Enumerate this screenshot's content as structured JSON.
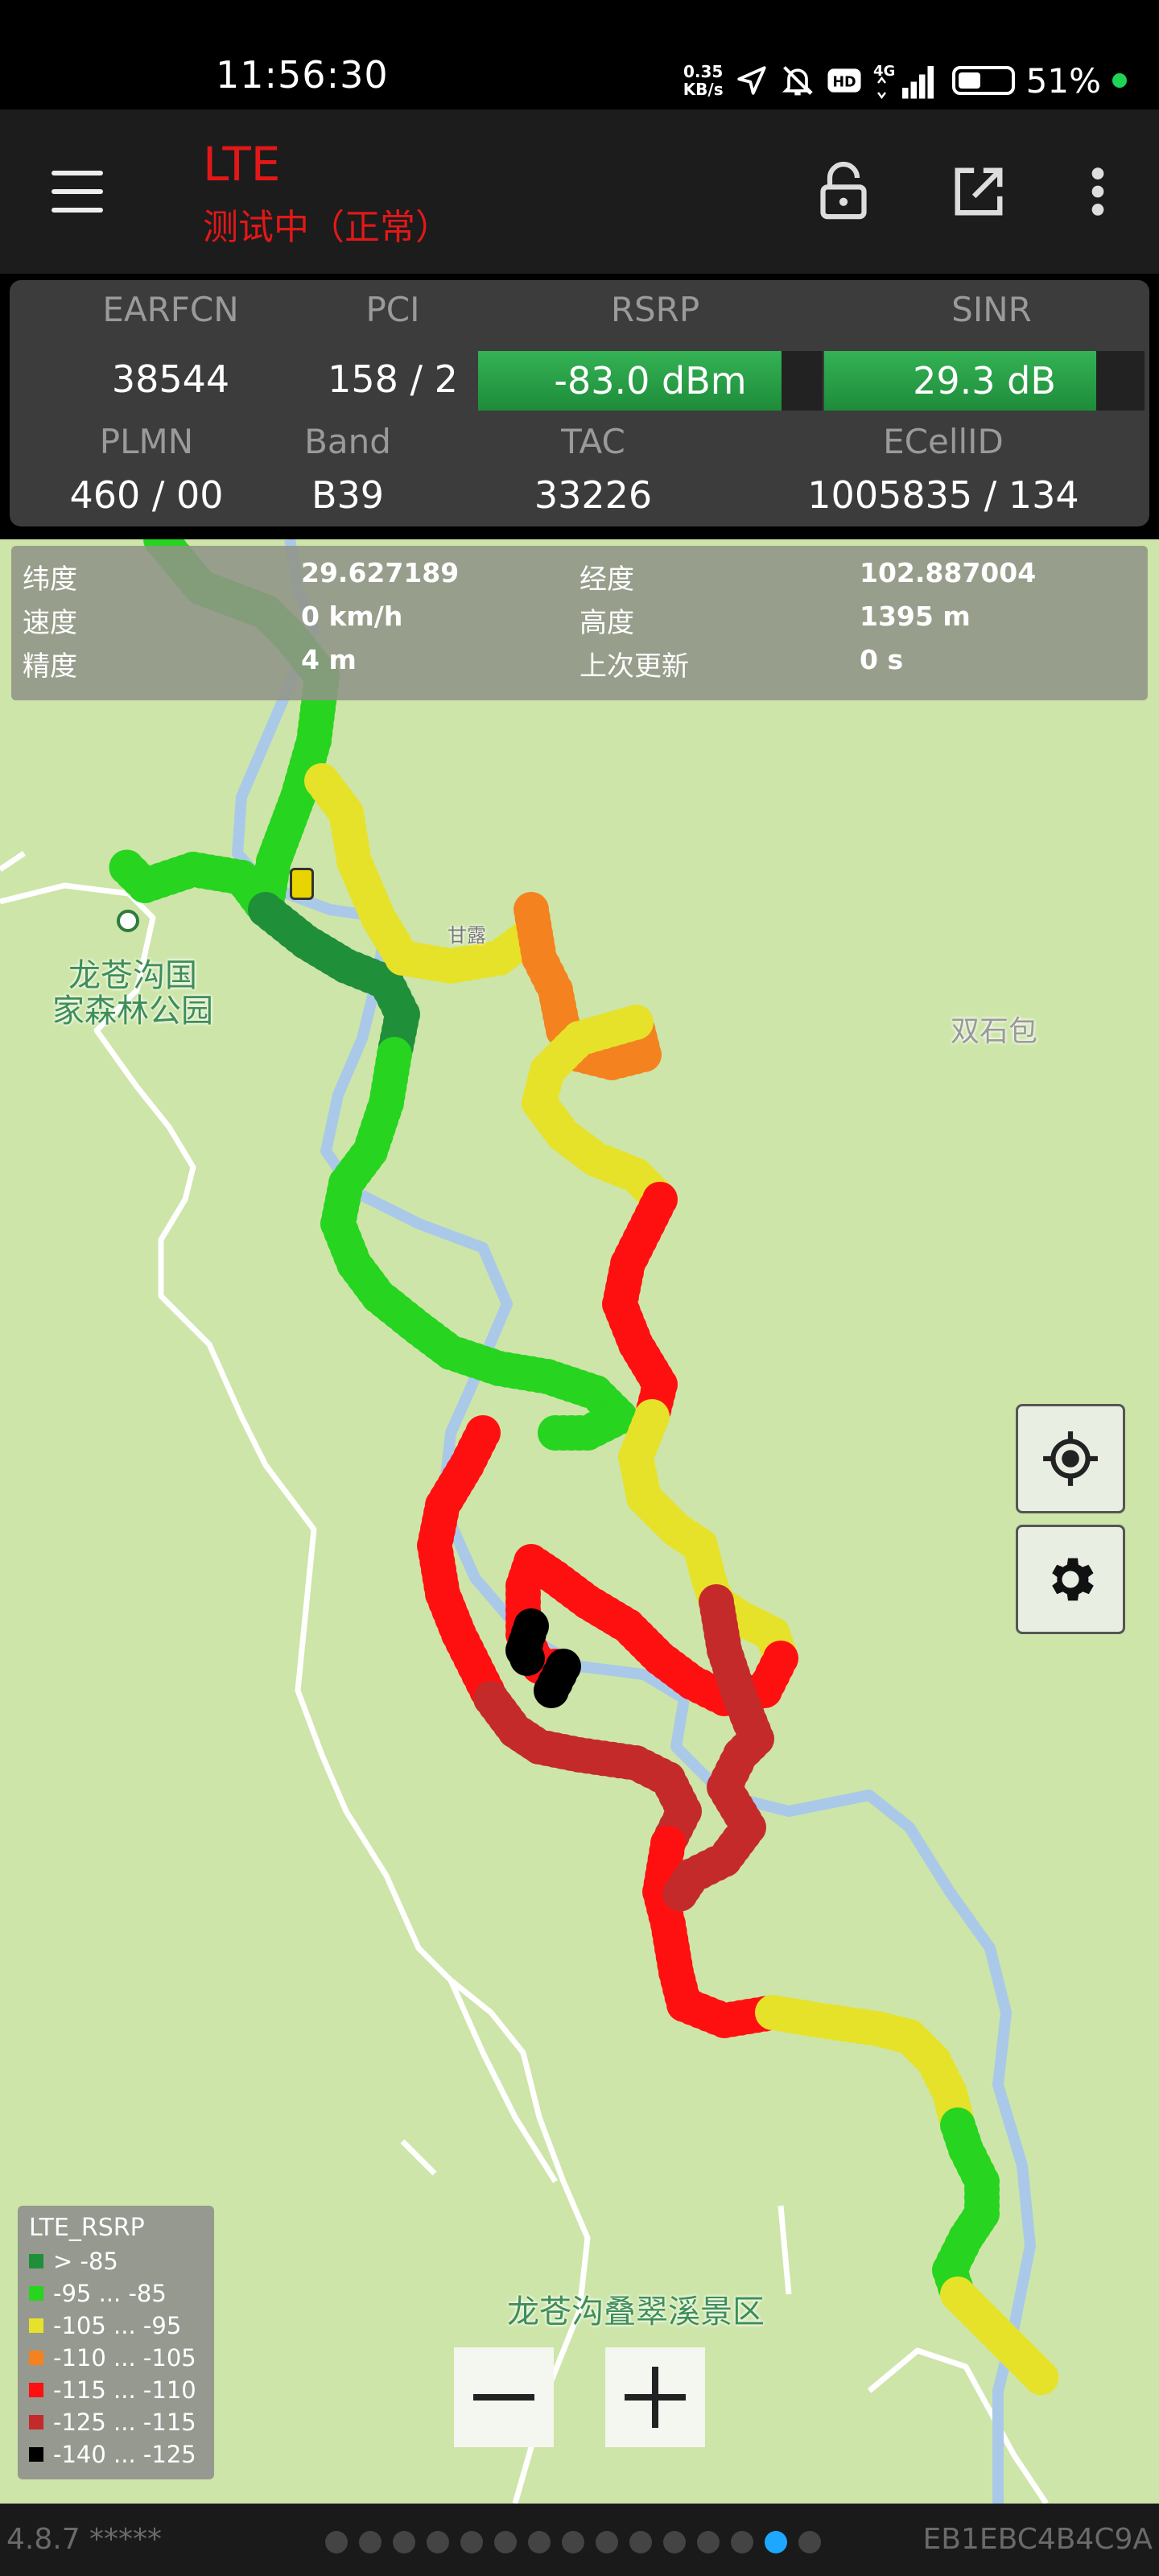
{
  "status_bar": {
    "time": "11:56:30",
    "speed_value": "0.35",
    "speed_unit": "KB/s",
    "network": "4G",
    "battery_percent": "51%",
    "battery_level": 0.51,
    "icons": [
      "location-arrow-icon",
      "bell-off-icon",
      "hd-icon",
      "signal-icon",
      "battery-icon"
    ]
  },
  "app_bar": {
    "title": "LTE",
    "subtitle": "测试中（正常）",
    "title_color": "#e21818",
    "icons": [
      "menu-icon",
      "lock-open-icon",
      "external-link-icon",
      "more-vert-icon"
    ]
  },
  "cell_info": {
    "earfcn_label": "EARFCN",
    "earfcn": "38544",
    "pci_label": "PCI",
    "pci": "158 / 2",
    "rsrp_label": "RSRP",
    "rsrp": "-83.0 dBm",
    "rsrp_fill": 0.88,
    "sinr_label": "SINR",
    "sinr": "29.3 dB",
    "sinr_fill": 0.85,
    "plmn_label": "PLMN",
    "plmn": "460 / 00",
    "band_label": "Band",
    "band": "B39",
    "tac_label": "TAC",
    "tac": "33226",
    "ecellid_label": "ECellID",
    "ecellid": "1005835 / 134",
    "meter_color": "#2aa64a"
  },
  "gps": {
    "lat_label": "纬度",
    "lat": "29.627189",
    "lon_label": "经度",
    "lon": "102.887004",
    "speed_label": "速度",
    "speed": "0 km/h",
    "alt_label": "高度",
    "alt": "1395 m",
    "acc_label": "精度",
    "acc": "4 m",
    "last_label": "上次更新",
    "last": "0 s"
  },
  "map": {
    "place_1": "龙苍沟国\n家森林公园",
    "place_2": "双石包",
    "place_3": "龙苍沟叠翠溪景区",
    "place_4": "甘露",
    "buttons": [
      "my-location-icon",
      "settings-icon"
    ],
    "zoom_out": "−",
    "zoom_in": "+"
  },
  "legend": {
    "title": "LTE_RSRP",
    "items": [
      {
        "label": "> -85",
        "color": "#1f8f3a"
      },
      {
        "label": "-95 ... -85",
        "color": "#27d41f"
      },
      {
        "label": "-105 ... -95",
        "color": "#e6e22a"
      },
      {
        "label": "-110 ... -105",
        "color": "#f4821f"
      },
      {
        "label": "-115 ... -110",
        "color": "#ff1010"
      },
      {
        "label": "-125 ... -115",
        "color": "#c42a2a"
      },
      {
        "label": "-140 ... -125",
        "color": "#000000"
      }
    ]
  },
  "bottom_bar": {
    "version": "4.8.7 *****",
    "id": "EB1EBC4B4C9A",
    "page_count": 15,
    "active_page": 13,
    "active_color": "#1ea7ff"
  }
}
